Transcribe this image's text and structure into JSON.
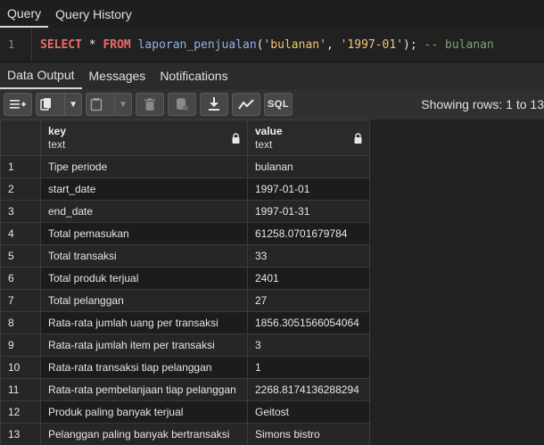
{
  "top_tabs": [
    {
      "label": "Query",
      "active": true
    },
    {
      "label": "Query History",
      "active": false
    }
  ],
  "editor": {
    "line_number": "1",
    "kw_select": "SELECT",
    "star": " * ",
    "kw_from": "FROM",
    "func": "laporan_penjualan",
    "paren_open": "(",
    "arg1": "'bulanan'",
    "comma": ", ",
    "arg2": "'1997-01'",
    "paren_close": ");",
    "comment": "-- bulanan"
  },
  "result_tabs": [
    {
      "label": "Data Output",
      "active": true
    },
    {
      "label": "Messages",
      "active": false
    },
    {
      "label": "Notifications",
      "active": false
    }
  ],
  "toolbar": {
    "icons": [
      "add-row-icon",
      "copy-icon",
      "paste-icon",
      "delete-icon",
      "save-data-icon",
      "download-icon",
      "graph-icon",
      "sql-icon"
    ],
    "sql_label": "SQL",
    "showing": "Showing rows: 1 to 13"
  },
  "grid": {
    "columns": [
      {
        "name": "key",
        "type": "text"
      },
      {
        "name": "value",
        "type": "text"
      }
    ],
    "rows": [
      {
        "n": "1",
        "key": "Tipe periode",
        "value": "bulanan"
      },
      {
        "n": "2",
        "key": "start_date",
        "value": "1997-01-01"
      },
      {
        "n": "3",
        "key": "end_date",
        "value": "1997-01-31"
      },
      {
        "n": "4",
        "key": "Total pemasukan",
        "value": "61258.0701679784"
      },
      {
        "n": "5",
        "key": "Total transaksi",
        "value": "33"
      },
      {
        "n": "6",
        "key": "Total produk terjual",
        "value": "2401"
      },
      {
        "n": "7",
        "key": "Total pelanggan",
        "value": "27"
      },
      {
        "n": "8",
        "key": "Rata-rata jumlah uang per transaksi",
        "value": "1856.3051566054064"
      },
      {
        "n": "9",
        "key": "Rata-rata jumlah item per transaksi",
        "value": "3"
      },
      {
        "n": "10",
        "key": "Rata-rata transaksi tiap pelanggan",
        "value": "1"
      },
      {
        "n": "11",
        "key": "Rata-rata pembelanjaan tiap pelanggan",
        "value": "2268.8174136288294"
      },
      {
        "n": "12",
        "key": "Produk paling banyak terjual",
        "value": "Geitost"
      },
      {
        "n": "13",
        "key": "Pelanggan paling banyak bertransaksi",
        "value": "Simons bistro"
      }
    ]
  }
}
